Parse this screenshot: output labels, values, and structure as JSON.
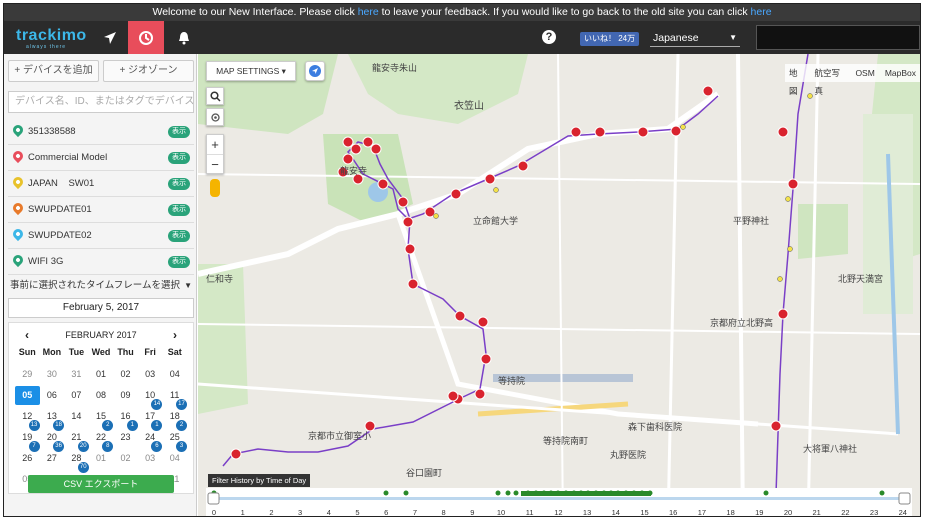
{
  "banner": {
    "text_before": "Welcome to our New Interface. Please click ",
    "link1": "here",
    "text_middle": " to leave your feedback. If you would like to go back to the old site you can click ",
    "link2": "here"
  },
  "topbar": {
    "logo": "trackimo",
    "logo_sub": "always there",
    "help": "?",
    "fb_like": "いいね！ 24万",
    "language": "Japanese"
  },
  "sidebar": {
    "add_device": "+ デバイスを追加",
    "geozone": "+ ジオゾーン",
    "search_placeholder": "デバイス名、ID、またはタグでデバイスを検索",
    "devices": [
      {
        "name": "351338588",
        "button": "表示",
        "color": "#2aa37a"
      },
      {
        "name": "Commercial Model",
        "button": "表示",
        "color": "#e84d5b"
      },
      {
        "name": "JAPAN    SW01",
        "button": "表示",
        "color": "#e8c22b"
      },
      {
        "name": "SWUPDATE01",
        "button": "表示",
        "color": "#e87a2b"
      },
      {
        "name": "SWUPDATE02",
        "button": "表示",
        "color": "#3cb7e8"
      },
      {
        "name": "WIFI 3G",
        "button": "表示",
        "color": "#2aa37a"
      }
    ],
    "timeframe": "事前に選択されたタイムフレームを選択",
    "date": "February 5, 2017",
    "calendar": {
      "month": "FEBRUARY 2017",
      "dow": [
        "Sun",
        "Mon",
        "Tue",
        "Wed",
        "Thu",
        "Fri",
        "Sat"
      ],
      "weeks": [
        [
          {
            "d": "29",
            "m": true
          },
          {
            "d": "30",
            "m": true
          },
          {
            "d": "31",
            "m": true
          },
          {
            "d": "01"
          },
          {
            "d": "02"
          },
          {
            "d": "03"
          },
          {
            "d": "04"
          }
        ],
        [
          {
            "d": "05",
            "sel": true
          },
          {
            "d": "06"
          },
          {
            "d": "07"
          },
          {
            "d": "08"
          },
          {
            "d": "09"
          },
          {
            "d": "10",
            "b": "14"
          },
          {
            "d": "11",
            "b": "17"
          }
        ],
        [
          {
            "d": "12",
            "b": "13"
          },
          {
            "d": "13",
            "b": "18"
          },
          {
            "d": "14"
          },
          {
            "d": "15",
            "b": "2"
          },
          {
            "d": "16",
            "b": "1"
          },
          {
            "d": "17",
            "b": "1"
          },
          {
            "d": "18",
            "b": "2"
          }
        ],
        [
          {
            "d": "19",
            "b": "7"
          },
          {
            "d": "20",
            "b": "36"
          },
          {
            "d": "21",
            "b": "20"
          },
          {
            "d": "22",
            "b": "8"
          },
          {
            "d": "23"
          },
          {
            "d": "24",
            "b": "6"
          },
          {
            "d": "25",
            "b": "3"
          }
        ],
        [
          {
            "d": "26"
          },
          {
            "d": "27"
          },
          {
            "d": "28",
            "b": "70"
          },
          {
            "d": "01",
            "m": true
          },
          {
            "d": "02",
            "m": true
          },
          {
            "d": "03",
            "m": true
          },
          {
            "d": "04",
            "m": true
          }
        ],
        [
          {
            "d": "05",
            "m": true
          },
          {
            "d": "06",
            "m": true
          },
          {
            "d": "07",
            "m": true
          },
          {
            "d": "08",
            "m": true
          },
          {
            "d": "09",
            "m": true
          },
          {
            "d": "10",
            "m": true
          },
          {
            "d": "11",
            "m": true
          }
        ]
      ]
    },
    "csv_export": "CSV エクスポート"
  },
  "map": {
    "settings": "MAP SETTINGS",
    "types": [
      "地図",
      "航空写真",
      "OSM",
      "MapBox"
    ],
    "filter_label": "Filter History by Time of Day",
    "hours": [
      "0",
      "1",
      "2",
      "3",
      "4",
      "5",
      "6",
      "7",
      "8",
      "9",
      "10",
      "11",
      "12",
      "13",
      "14",
      "15",
      "16",
      "17",
      "18",
      "19",
      "20",
      "21",
      "22",
      "23",
      "24"
    ],
    "labels": [
      {
        "t": "龍安寺朱山"
      },
      {
        "t": "衣笠山"
      },
      {
        "t": "龍安寺"
      },
      {
        "t": "仁和寺"
      },
      {
        "t": "立命館大学"
      },
      {
        "t": "等持院"
      },
      {
        "t": "京都市立御室小"
      },
      {
        "t": "北野天満宮"
      },
      {
        "t": "平野神社"
      },
      {
        "t": "京都府立北野高"
      },
      {
        "t": "大将軍八神社"
      },
      {
        "t": "丸野医院"
      },
      {
        "t": "森下歯科医院"
      },
      {
        "t": "等持院南町"
      },
      {
        "t": "谷口園町"
      }
    ]
  }
}
